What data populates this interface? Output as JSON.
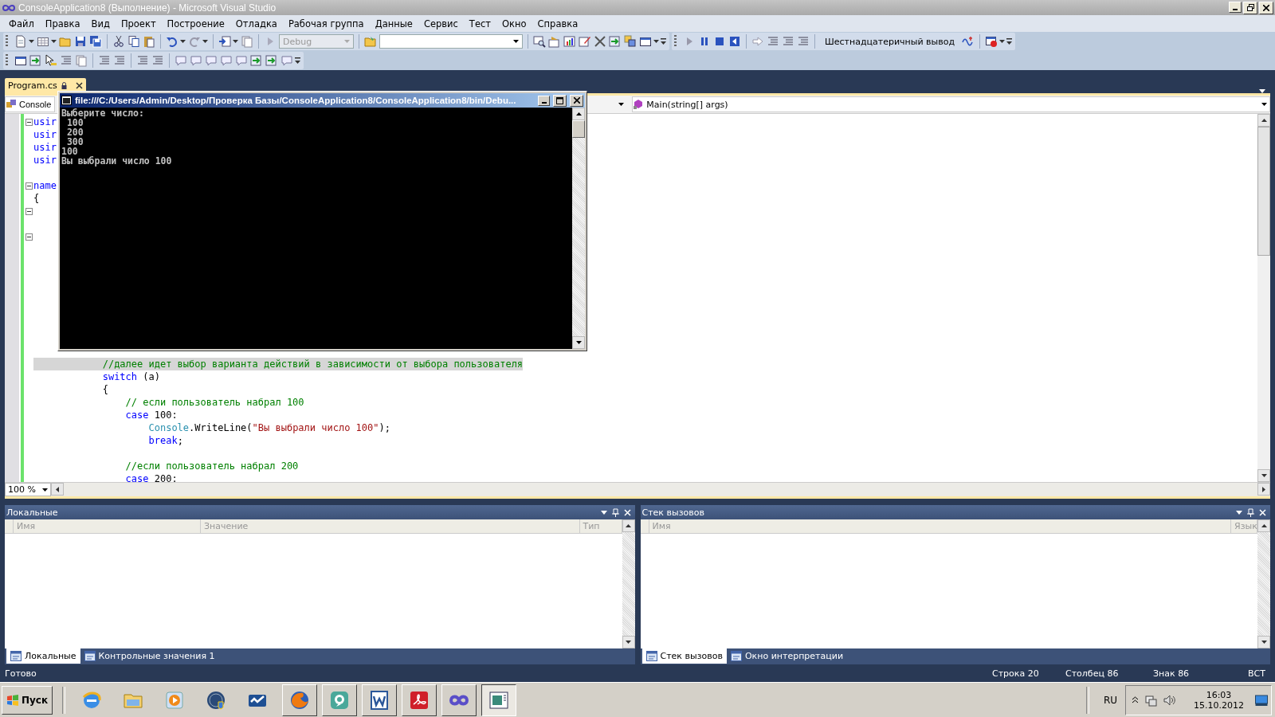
{
  "window": {
    "title": "ConsoleApplication8 (Выполнение) - Microsoft Visual Studio"
  },
  "menu": [
    "Файл",
    "Правка",
    "Вид",
    "Проект",
    "Построение",
    "Отладка",
    "Рабочая группа",
    "Данные",
    "Сервис",
    "Тест",
    "Окно",
    "Справка"
  ],
  "toolbar": {
    "configuration_combo": {
      "value": "Debug",
      "disabled": true
    },
    "hex_display_button": "Шестнадцатеричный вывод"
  },
  "document_tabs": [
    {
      "label": "Program.cs",
      "selected": true
    }
  ],
  "navigation": {
    "type_combo": "Console",
    "member_combo": "Main(string[] args)"
  },
  "editor": {
    "zoom": "100 %",
    "lines": [
      {
        "fold": true,
        "highlighted": false,
        "tokens": [
          {
            "text": "usir",
            "kind": "keyword"
          }
        ]
      },
      {
        "fold": false,
        "highlighted": false,
        "tokens": [
          {
            "text": "usir",
            "kind": "keyword"
          }
        ]
      },
      {
        "fold": false,
        "highlighted": false,
        "tokens": [
          {
            "text": "usir",
            "kind": "keyword"
          }
        ]
      },
      {
        "fold": false,
        "highlighted": false,
        "tokens": [
          {
            "text": "usir",
            "kind": "keyword"
          }
        ]
      },
      {
        "fold": false,
        "highlighted": false
      },
      {
        "fold": true,
        "highlighted": false,
        "tokens": [
          {
            "text": "name",
            "kind": "keyword"
          }
        ]
      },
      {
        "fold": false,
        "highlighted": false,
        "tokens": [
          {
            "text": "{",
            "kind": "plain"
          }
        ]
      },
      {
        "fold": true,
        "highlighted": false
      },
      {
        "fold": false,
        "highlighted": false
      },
      {
        "fold": true,
        "highlighted": false
      },
      {
        "fold": false,
        "highlighted": false
      },
      {
        "fold": false,
        "highlighted": false
      },
      {
        "fold": false,
        "highlighted": false
      },
      {
        "fold": false,
        "highlighted": false
      },
      {
        "fold": false,
        "highlighted": false
      },
      {
        "fold": false,
        "highlighted": false
      },
      {
        "fold": false,
        "highlighted": false
      },
      {
        "fold": false,
        "highlighted": false
      },
      {
        "fold": false,
        "highlighted": false
      },
      {
        "fold": false,
        "highlighted": true,
        "tokens": [
          {
            "text": "            //далее идет выбор варианта действий в зависимости от выбора пользователя",
            "kind": "comment"
          }
        ]
      },
      {
        "fold": false,
        "highlighted": false,
        "tokens": [
          {
            "text": "            switch",
            "kind": "keyword"
          },
          {
            "text": " (a)",
            "kind": "plain"
          }
        ]
      },
      {
        "fold": false,
        "highlighted": false,
        "tokens": [
          {
            "text": "            {",
            "kind": "plain"
          }
        ]
      },
      {
        "fold": false,
        "highlighted": false,
        "tokens": [
          {
            "text": "                // если пользователь набрал 100",
            "kind": "comment"
          }
        ]
      },
      {
        "fold": false,
        "highlighted": false,
        "tokens": [
          {
            "text": "                case",
            "kind": "keyword"
          },
          {
            "text": " 100:",
            "kind": "plain"
          }
        ]
      },
      {
        "fold": false,
        "highlighted": false,
        "tokens": [
          {
            "text": "                    Console",
            "kind": "type"
          },
          {
            "text": ".WriteLine(",
            "kind": "plain"
          },
          {
            "text": "\"Вы выбрали число 100\"",
            "kind": "string"
          },
          {
            "text": ");",
            "kind": "plain"
          }
        ]
      },
      {
        "fold": false,
        "highlighted": false,
        "tokens": [
          {
            "text": "                    break",
            "kind": "keyword"
          },
          {
            "text": ";",
            "kind": "plain"
          }
        ]
      },
      {
        "fold": false,
        "highlighted": false
      },
      {
        "fold": false,
        "highlighted": false,
        "tokens": [
          {
            "text": "                //если пользователь набрал 200",
            "kind": "comment"
          }
        ]
      },
      {
        "fold": false,
        "highlighted": false,
        "tokens": [
          {
            "text": "                case",
            "kind": "keyword"
          },
          {
            "text": " 200:",
            "kind": "plain"
          }
        ]
      }
    ]
  },
  "console_window": {
    "title": "file:///C:/Users/Admin/Desktop/Проверка Базы/ConsoleApplication8/ConsoleApplication8/bin/Debu...",
    "lines": [
      "Выберите число:",
      " 100",
      " 200",
      " 300",
      "100",
      "Вы выбрали число 100"
    ]
  },
  "panels": [
    {
      "title": "Локальные",
      "columns": [
        "Имя",
        "Значение",
        "Тип"
      ],
      "tabs": [
        {
          "label": "Локальные",
          "selected": true
        },
        {
          "label": "Контрольные значения 1",
          "selected": false
        }
      ]
    },
    {
      "title": "Стек вызовов",
      "columns": [
        "Имя",
        "Язык"
      ],
      "tabs": [
        {
          "label": "Стек вызовов",
          "selected": true
        },
        {
          "label": "Окно интерпретации",
          "selected": false
        }
      ]
    }
  ],
  "status_bar": {
    "message": "Готово",
    "line": "Строка 20",
    "column": "Столбец 86",
    "char": "Знак 86",
    "mode": "ВСТ"
  },
  "taskbar": {
    "start": "Пуск",
    "language": "RU",
    "time": "16:03",
    "date": "15.10.2012"
  }
}
